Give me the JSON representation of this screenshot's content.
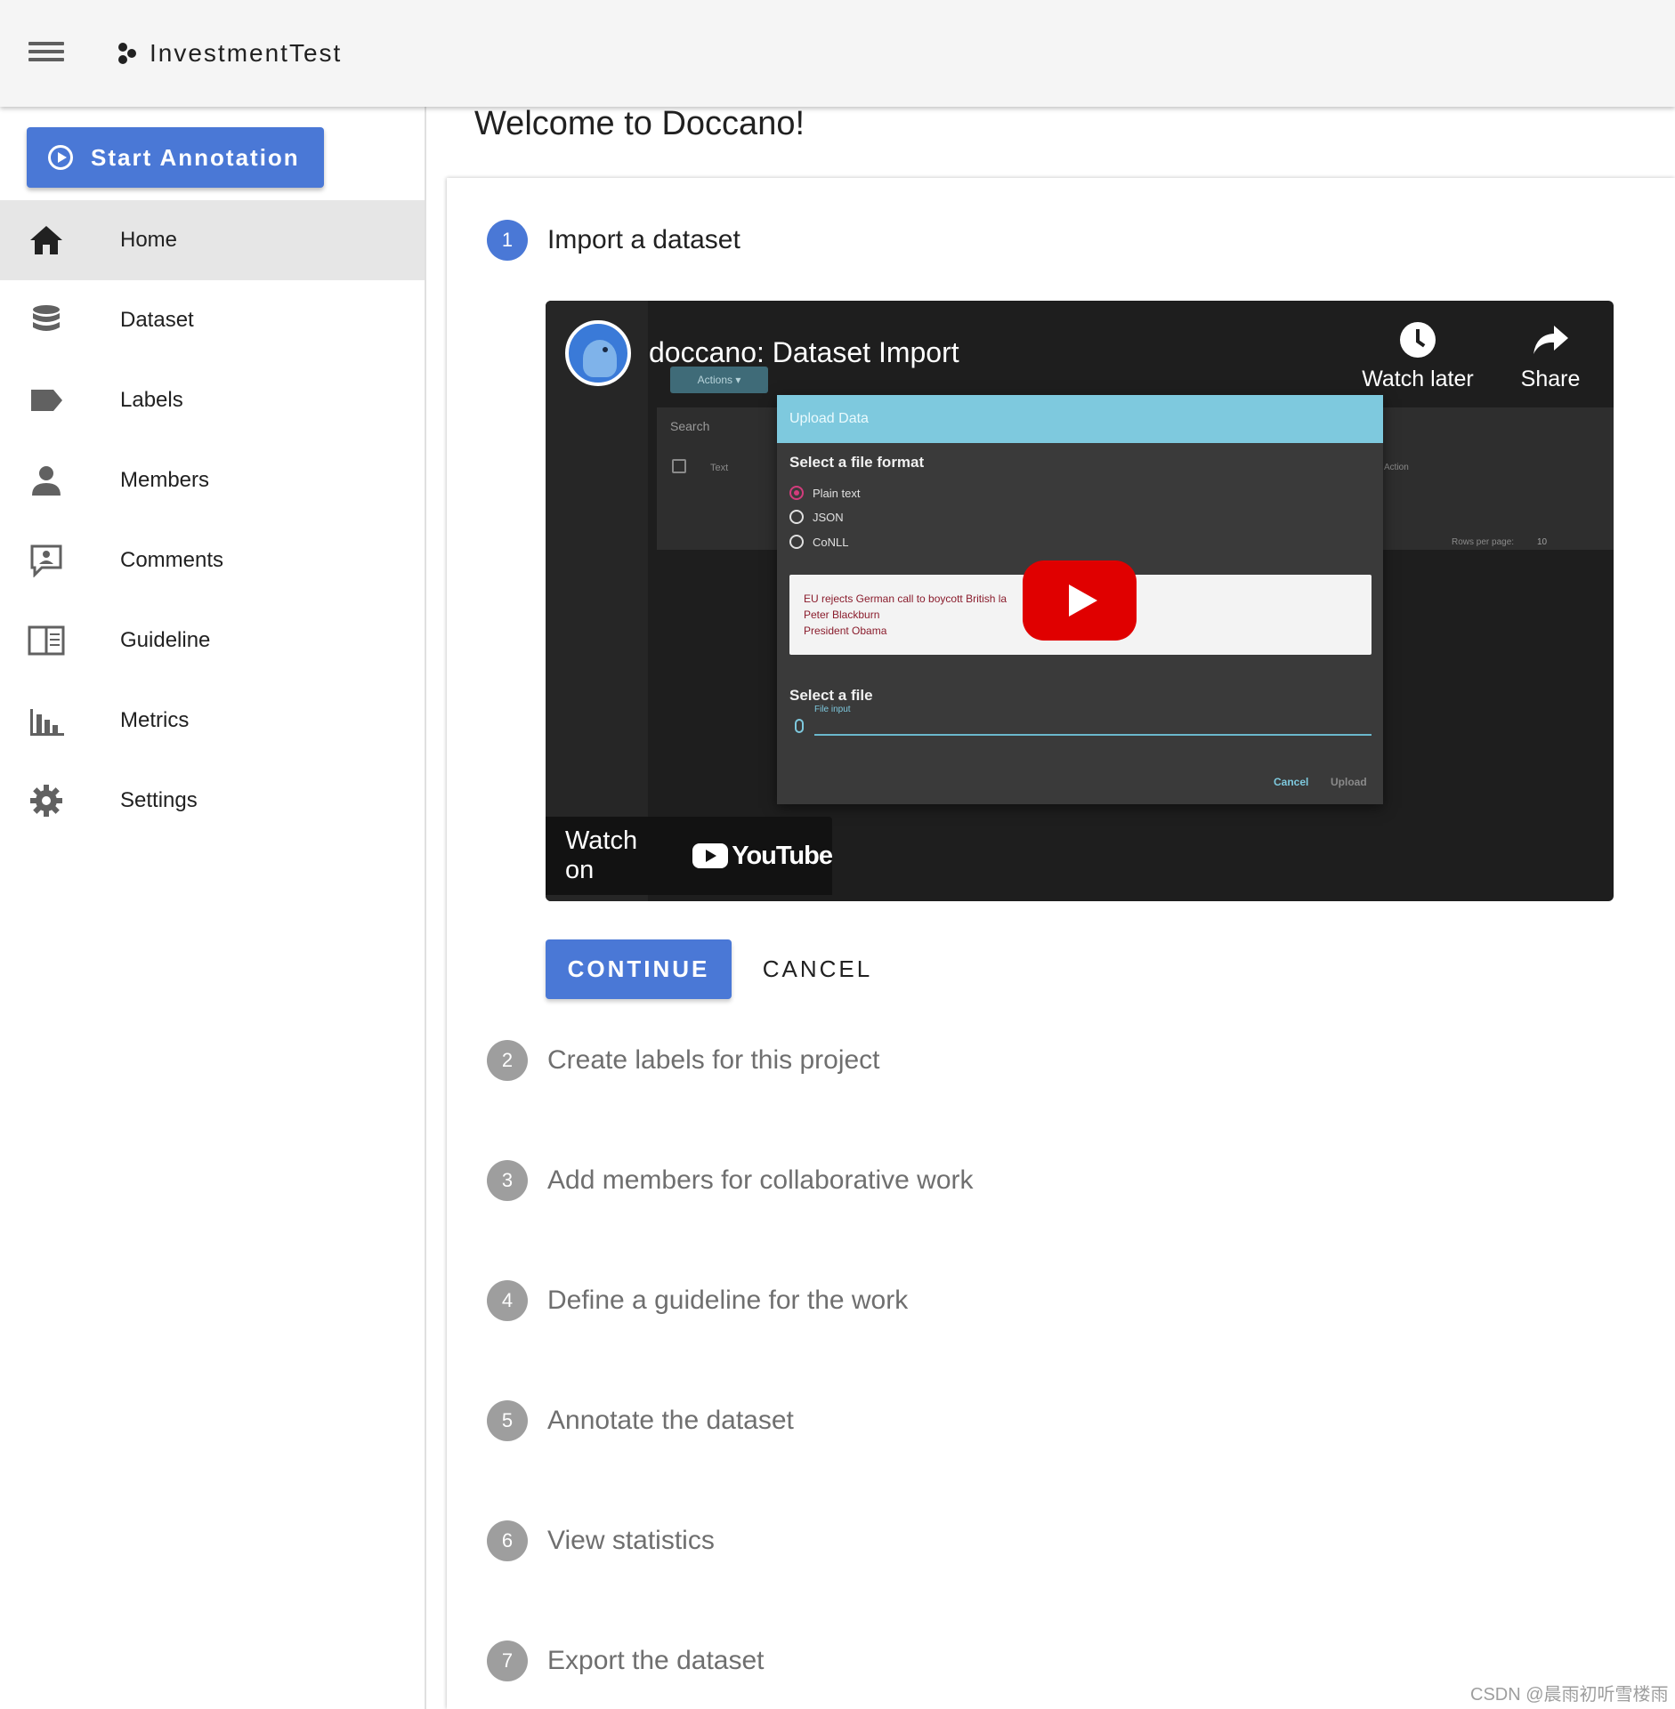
{
  "appbar": {
    "project_name": "InvestmentTest"
  },
  "sidebar": {
    "start_button": "Start Annotation",
    "items": [
      {
        "label": "Home",
        "icon": "home-icon",
        "active": true
      },
      {
        "label": "Dataset",
        "icon": "database-icon"
      },
      {
        "label": "Labels",
        "icon": "label-icon"
      },
      {
        "label": "Members",
        "icon": "person-icon"
      },
      {
        "label": "Comments",
        "icon": "comment-icon"
      },
      {
        "label": "Guideline",
        "icon": "book-icon"
      },
      {
        "label": "Metrics",
        "icon": "bar-chart-icon"
      },
      {
        "label": "Settings",
        "icon": "gear-icon"
      }
    ]
  },
  "main": {
    "title": "Welcome to Doccano!",
    "steps": [
      {
        "num": "1",
        "label": "Import a dataset"
      },
      {
        "num": "2",
        "label": "Create labels for this project"
      },
      {
        "num": "3",
        "label": "Add members for collaborative work"
      },
      {
        "num": "4",
        "label": "Define a guideline for the work"
      },
      {
        "num": "5",
        "label": "Annotate the dataset"
      },
      {
        "num": "6",
        "label": "View statistics"
      },
      {
        "num": "7",
        "label": "Export the dataset"
      }
    ],
    "continue_label": "CONTINUE",
    "cancel_label": "CANCEL"
  },
  "video": {
    "title": "doccano: Dataset Import",
    "watch_later": "Watch later",
    "share": "Share",
    "watch_on": "Watch on",
    "youtube": "YouTube",
    "inner": {
      "actions": "Actions ▾",
      "search": "Search",
      "text_col": "Text",
      "action_col": "Action",
      "rows_per_page": "Rows per page:",
      "rows_value": "10",
      "dialog_title": "Upload Data",
      "select_format": "Select a file format",
      "formats": [
        "Plain text",
        "JSON",
        "CoNLL"
      ],
      "sample_lines": [
        "EU rejects German call to boycott British la",
        "Peter Blackburn",
        "President Obama"
      ],
      "select_file": "Select a file",
      "file_input": "File input",
      "cancel": "Cancel",
      "upload": "Upload"
    }
  },
  "watermark": "CSDN @晨雨初听雪楼雨",
  "colors": {
    "primary": "#4a78d6",
    "appbar": "#f5f5f5",
    "youtube_red": "#e00000"
  }
}
